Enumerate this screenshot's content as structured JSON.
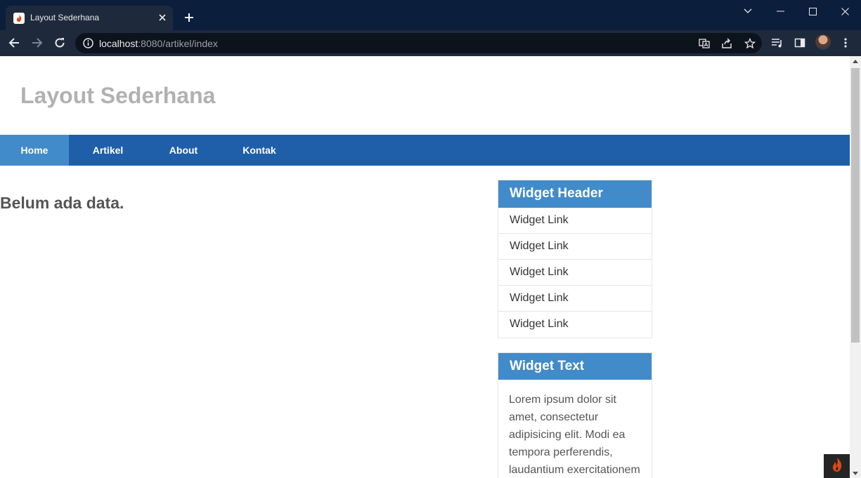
{
  "browser": {
    "tab_title": "Layout Sederhana",
    "url_host": "localhost",
    "url_path": ":8080/artikel/index"
  },
  "site": {
    "title": "Layout Sederhana"
  },
  "nav": {
    "items": [
      {
        "label": "Home",
        "active": true
      },
      {
        "label": "Artikel",
        "active": false
      },
      {
        "label": "About",
        "active": false
      },
      {
        "label": "Kontak",
        "active": false
      }
    ]
  },
  "main": {
    "empty_message": "Belum ada data."
  },
  "sidebar": {
    "widget_links": {
      "header": "Widget Header",
      "links": [
        "Widget Link",
        "Widget Link",
        "Widget Link",
        "Widget Link",
        "Widget Link"
      ]
    },
    "widget_text": {
      "header": "Widget Text",
      "body": "Lorem ipsum dolor sit amet, consectetur adipisicing elit. Modi ea tempora perferendis, laudantium exercitationem"
    }
  },
  "colors": {
    "nav_bg": "#1f5faa",
    "nav_active": "#428bca",
    "widget_header": "#428bca",
    "site_title": "#b1b1b1"
  }
}
